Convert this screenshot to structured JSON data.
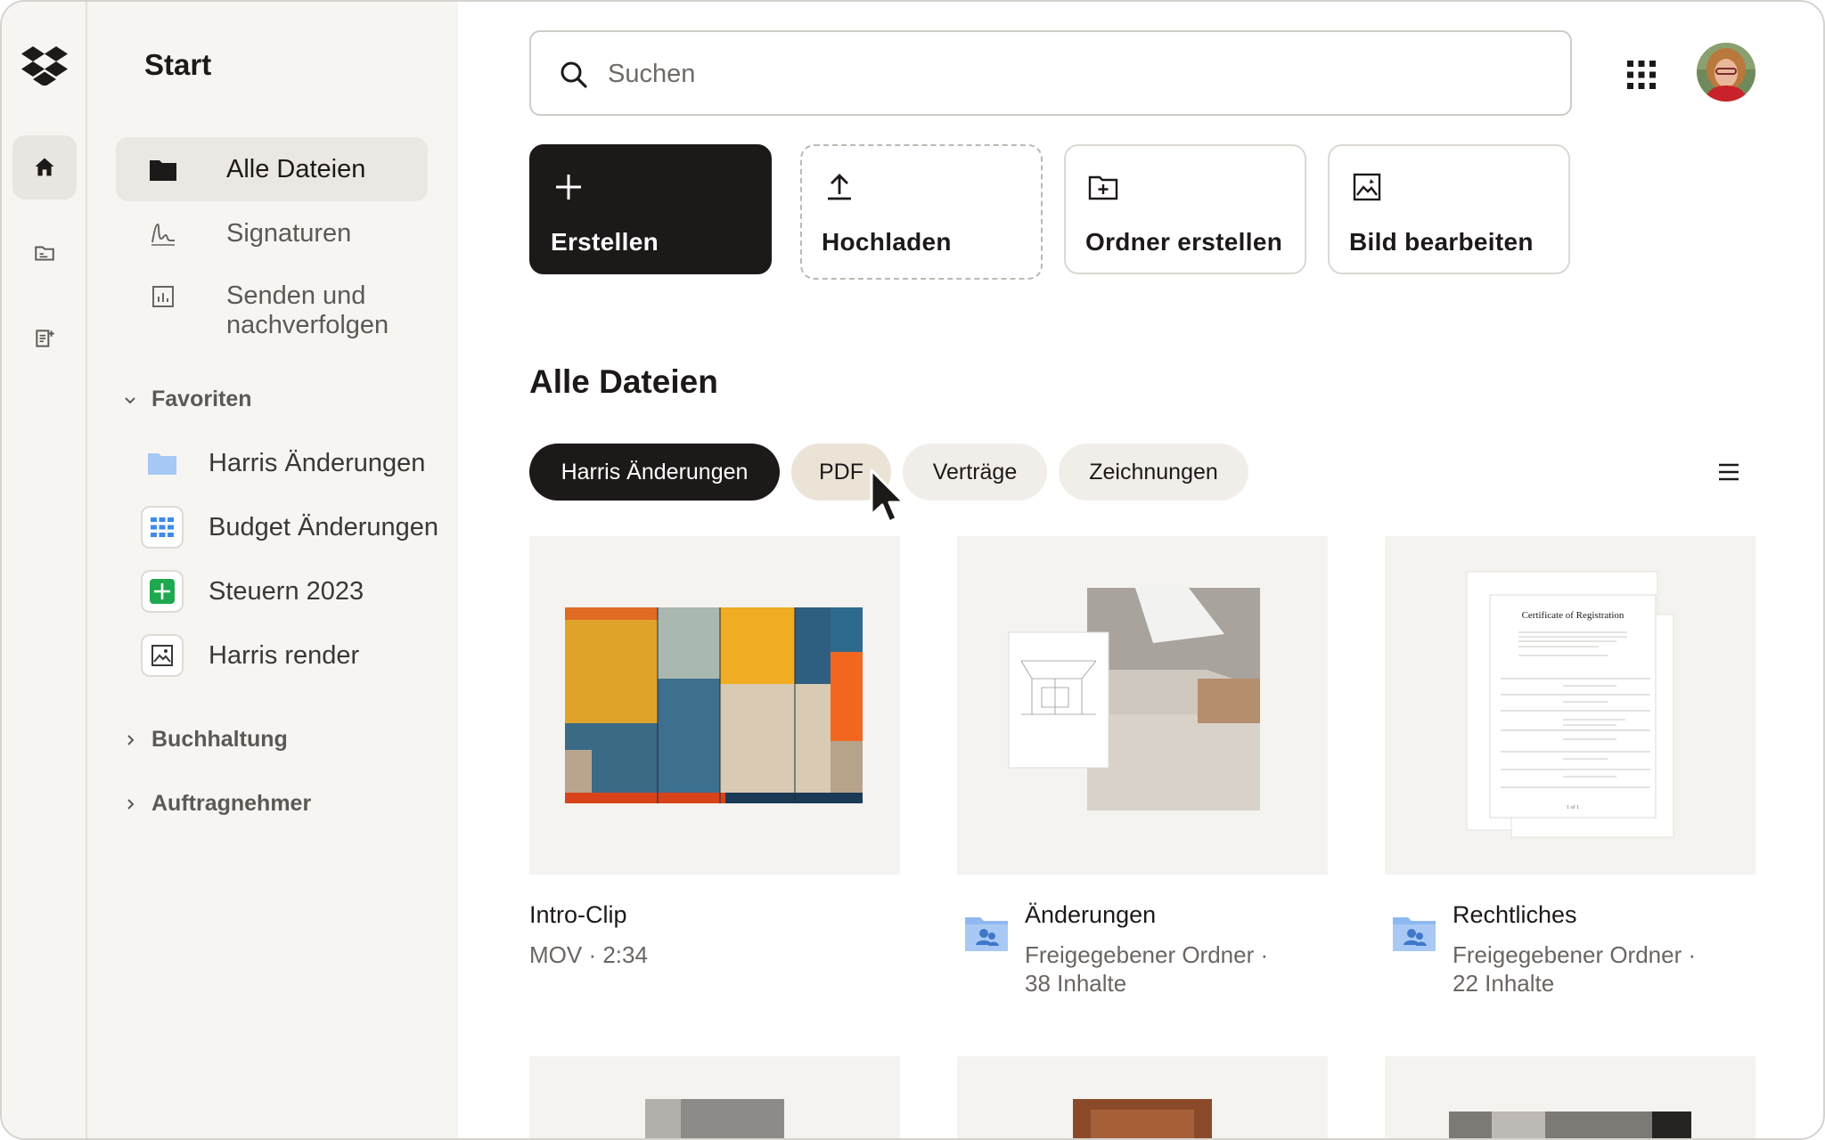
{
  "sidebar": {
    "title": "Start",
    "nav": [
      {
        "label": "Alle Dateien",
        "icon": "folder-filled-icon"
      },
      {
        "label": "Signaturen",
        "icon": "signature-icon"
      },
      {
        "label": "Senden und nachverfolgen",
        "icon": "chart-icon"
      }
    ],
    "favorites_label": "Favoriten",
    "favorites": [
      {
        "label": "Harris Änderungen",
        "icon": "folder-icon"
      },
      {
        "label": "Budget Änderungen",
        "icon": "grid-sheet-icon"
      },
      {
        "label": "Steuern 2023",
        "icon": "spreadsheet-icon"
      },
      {
        "label": "Harris render",
        "icon": "image-icon"
      }
    ],
    "sections": [
      {
        "label": "Buchhaltung"
      },
      {
        "label": "Auftragnehmer"
      }
    ]
  },
  "search": {
    "placeholder": "Suchen"
  },
  "actions": [
    {
      "label": "Erstellen",
      "icon": "plus-icon"
    },
    {
      "label": "Hochladen",
      "icon": "upload-icon"
    },
    {
      "label": "Ordner erstellen",
      "icon": "folder-add-icon"
    },
    {
      "label": "Bild bearbeiten",
      "icon": "image-edit-icon"
    }
  ],
  "main": {
    "title": "Alle Dateien",
    "filters": [
      {
        "label": "Harris Änderungen",
        "selected": true
      },
      {
        "label": "PDF",
        "selected": false
      },
      {
        "label": "Verträge",
        "selected": false
      },
      {
        "label": "Zeichnungen",
        "selected": false
      }
    ],
    "files": [
      {
        "name": "Intro-Clip",
        "meta_line1": "MOV · 2:34",
        "meta_line2": ""
      },
      {
        "name": "Änderungen",
        "meta_line1": "Freigegebener Ordner  ·",
        "meta_line2": "38 Inhalte"
      },
      {
        "name": "Rechtliches",
        "meta_line1": "Freigegebener Ordner  ·",
        "meta_line2": "22 Inhalte"
      }
    ],
    "document_preview": {
      "title": "Certificate of Registration",
      "page": "1 of 1"
    }
  },
  "colors": {
    "accent_dark": "#1e1919",
    "sidebar_bg": "#f7f5f2",
    "folder_blue": "#8fb8f0",
    "sheet_green": "#1ea94f",
    "grid_blue": "#3f8ae6"
  }
}
